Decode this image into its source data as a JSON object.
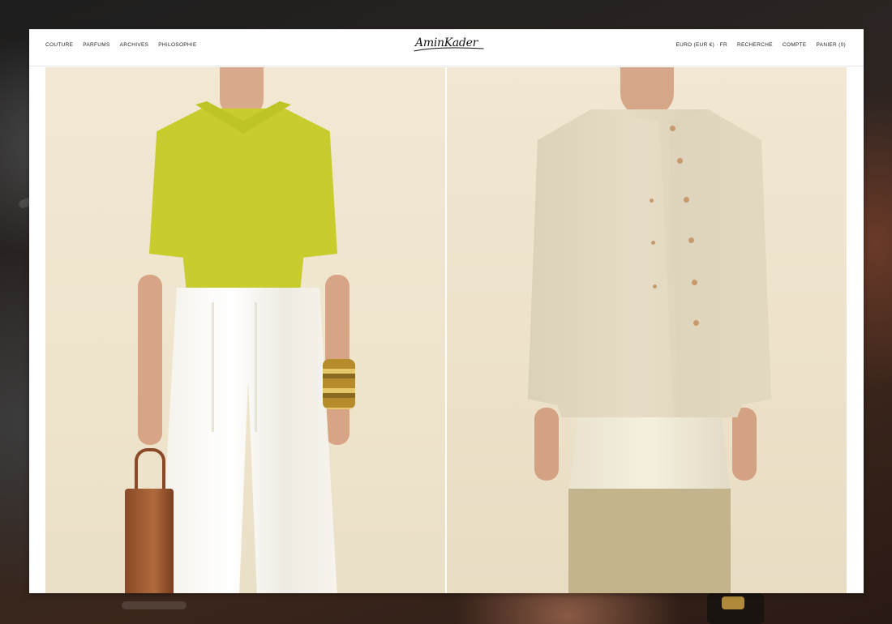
{
  "header": {
    "logo": "AminKader",
    "nav_left": [
      "COUTURE",
      "PARFUMS",
      "ARCHIVES",
      "PHILOSOPHIE"
    ],
    "nav_right": [
      "EURO (EUR €) · FR",
      "RECHERCHE",
      "COMPTE",
      "PANIER (0)"
    ]
  },
  "gallery": {
    "items": [
      {
        "product": "chartreuse-knit-polo-with-white-linen-trousers"
      },
      {
        "product": "beige-linen-cardigan-with-silk-top"
      }
    ]
  },
  "colors": {
    "background": "#2a1c16",
    "site_bg": "#ffffff",
    "photo_bg": "#f0e6d0"
  }
}
